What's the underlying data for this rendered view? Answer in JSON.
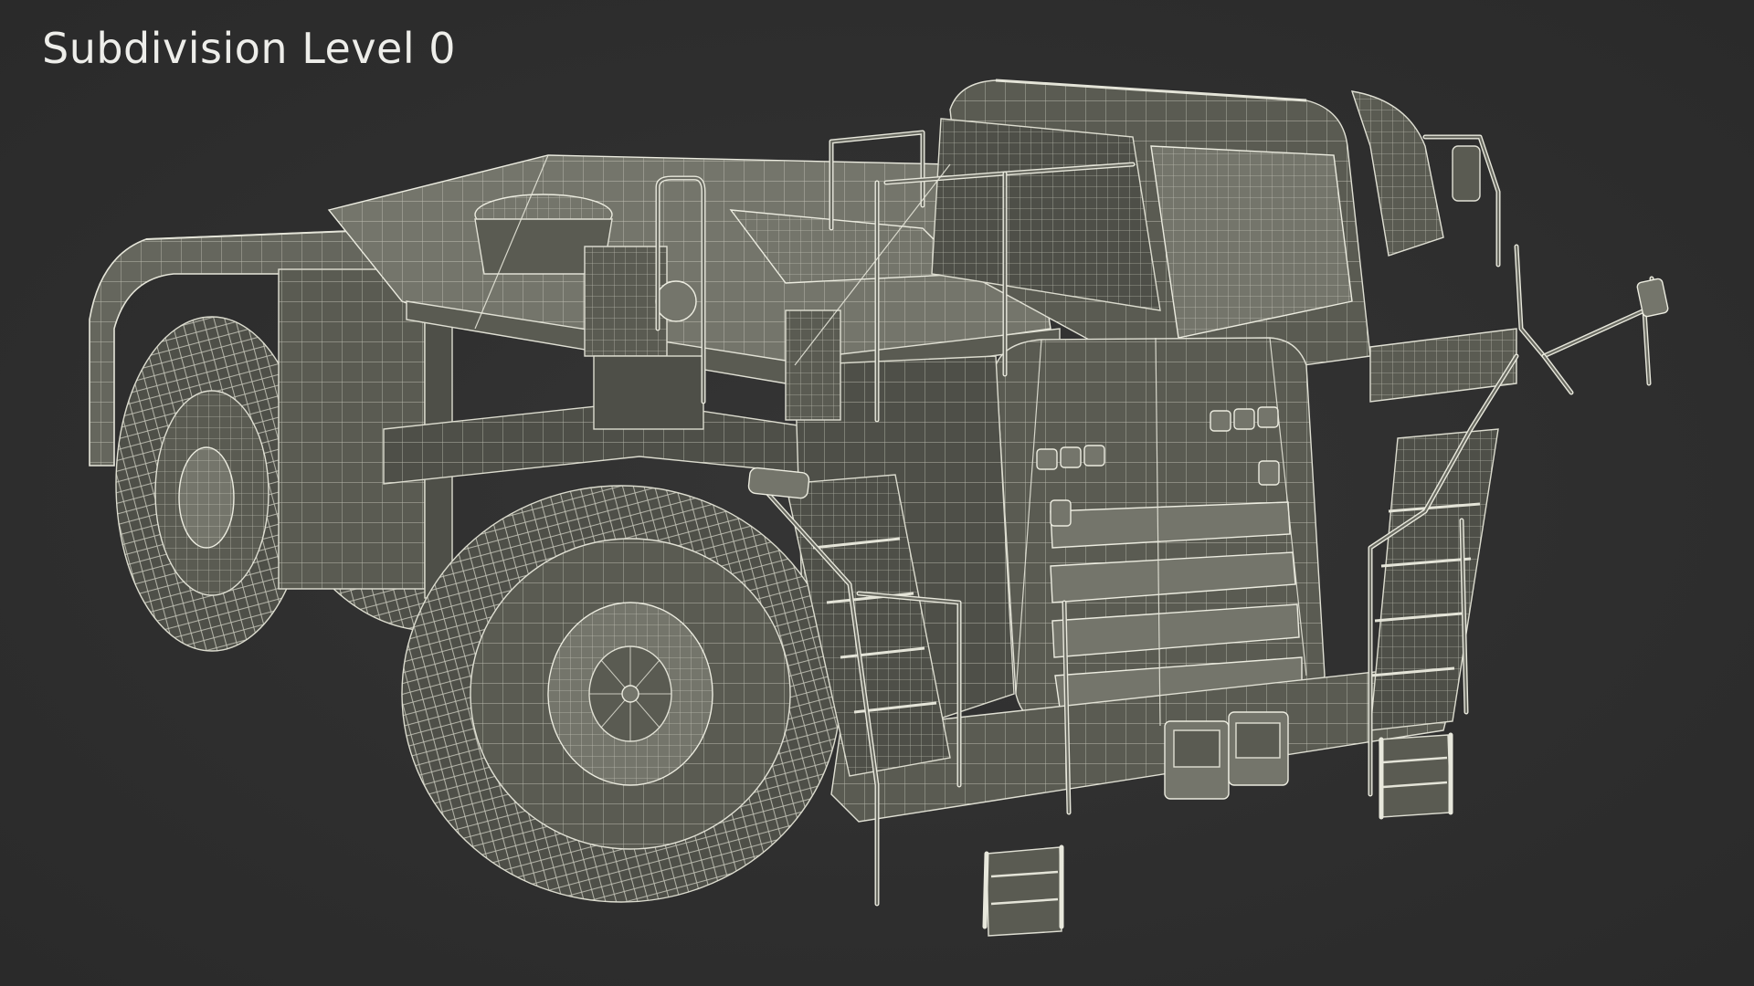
{
  "viewport": {
    "overlay_label": "Subdivision Level 0",
    "background_color": "#2f2f2f",
    "wireframe_color": "#e4e4d8",
    "surface_color": "#65665d"
  },
  "model": {
    "subject": "mining haul truck chassis wireframe render"
  }
}
